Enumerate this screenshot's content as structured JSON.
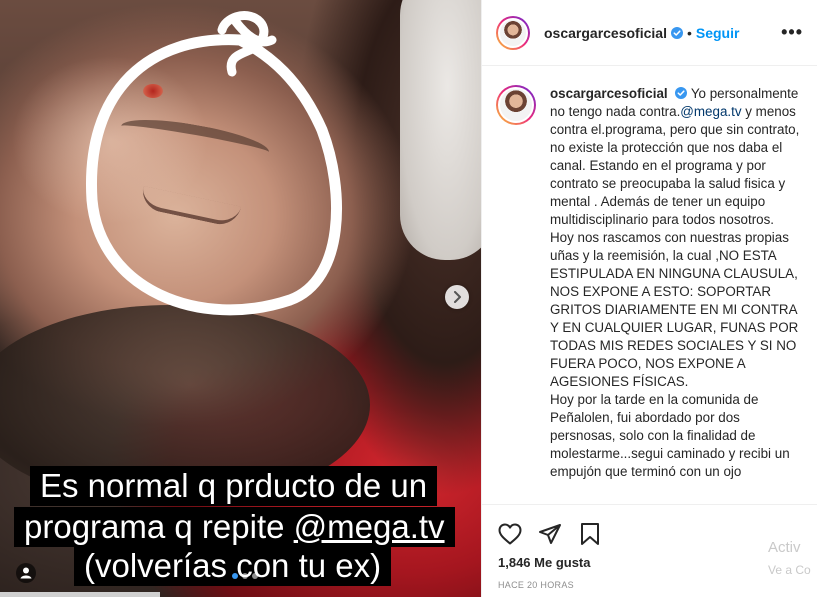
{
  "media": {
    "caption_lines": [
      "Es normal q prducto de un",
      "programa q repite ",
      "(volverías con tu ex)"
    ],
    "caption_mention": "@mega.tv",
    "next_icon": "chevron-right-icon",
    "user_tag_icon": "user-tag-icon",
    "carousel_dots": 3,
    "active_dot": 1
  },
  "header": {
    "username": "oscargarcesoficial",
    "separator": "•",
    "follow_label": "Seguir",
    "more_icon": "•••"
  },
  "post": {
    "username": "oscargarcesoficial",
    "text_intro": "Yo personalmente no tengo nada contra.",
    "mention": "@mega.tv",
    "text_rest": " y menos contra el.programa, pero que sin contrato, no existe la protección que nos daba el canal. Estando en el programa y por contrato se preocupaba la salud fisica y mental . Además de tener un equipo multidisciplinario para todos nosotros.\nHoy nos rascamos con nuestras propias uñas y la reemisión, la cual ,NO ESTA ESTIPULADA EN NINGUNA CLAUSULA, NOS EXPONE A ESTO: SOPORTAR GRITOS DIARIAMENTE EN MI CONTRA Y EN CUALQUIER LUGAR, FUNAS POR TODAS MIS REDES SOCIALES Y SI NO FUERA POCO, NOS EXPONE A AGESIONES FÍSICAS.\nHoy por la tarde en la comunida de Peñalolen, fui abordado por dos persnosas, solo con la finalidad de molestarme...segui caminado y recibi un empujón que terminó con un ojo"
  },
  "actions": {
    "like_icon": "heart-icon",
    "share_icon": "paper-plane-icon",
    "save_icon": "bookmark-icon",
    "likes_text": "1,846 Me gusta",
    "time_text": "HACE 20 HORAS"
  },
  "watermark": {
    "line1": "Activ",
    "line2": "Ve a Co"
  },
  "colors": {
    "follow": "#0095f6",
    "verified": "#3897f0",
    "mention": "#00376b"
  }
}
